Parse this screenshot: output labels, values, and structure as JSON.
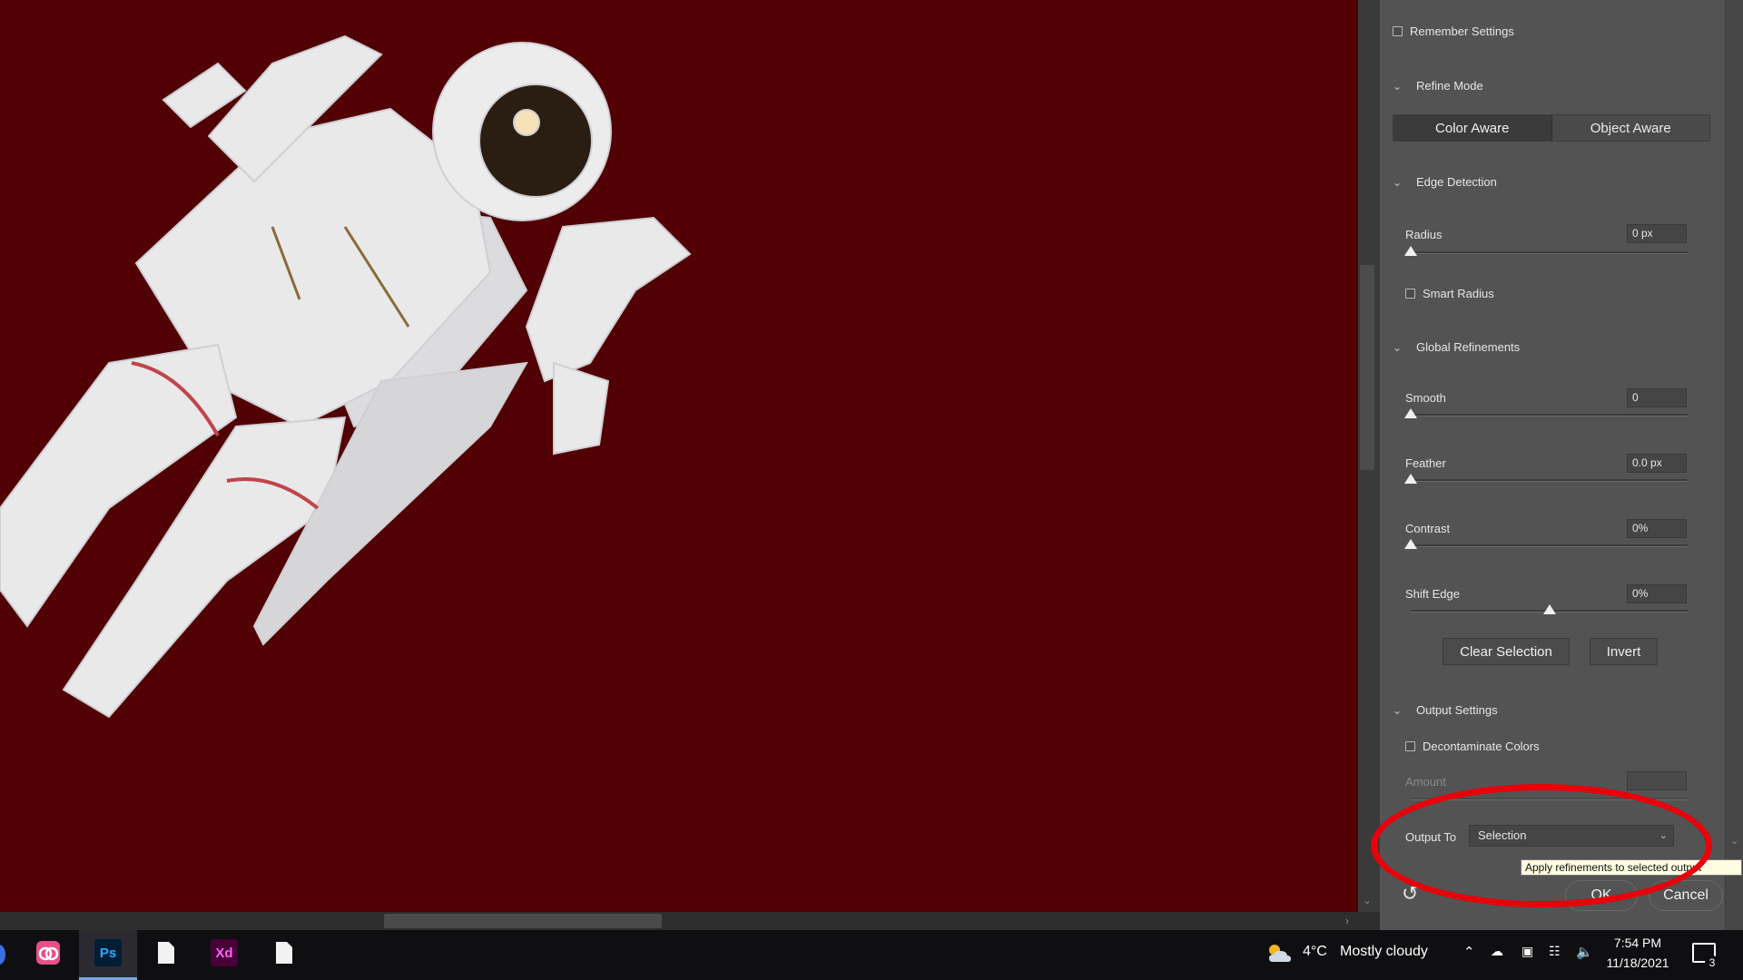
{
  "panel": {
    "remember_settings": "Remember Settings",
    "refine_mode": {
      "title": "Refine Mode",
      "options": [
        "Color Aware",
        "Object Aware"
      ],
      "selected": "Color Aware"
    },
    "edge_detection": {
      "title": "Edge Detection",
      "radius_label": "Radius",
      "radius_value": "0 px",
      "radius_level": 0,
      "smart_radius": "Smart Radius"
    },
    "global_refinements": {
      "title": "Global Refinements",
      "smooth_label": "Smooth",
      "smooth_value": "0",
      "smooth_level": 0,
      "feather_label": "Feather",
      "feather_value": "0.0 px",
      "feather_level": 0,
      "contrast_label": "Contrast",
      "contrast_value": "0%",
      "contrast_level": 0,
      "shift_edge_label": "Shift Edge",
      "shift_edge_value": "0%",
      "shift_edge_level": 0.5
    },
    "clear_selection": "Clear Selection",
    "invert": "Invert",
    "output_settings": {
      "title": "Output Settings",
      "decontaminate": "Decontaminate Colors",
      "amount_label": "Amount",
      "output_to_label": "Output To",
      "output_to_value": "Selection"
    },
    "tooltip": "Apply refinements to selected output",
    "ok": "OK",
    "cancel": "Cancel",
    "reset_icon": "reset-icon"
  },
  "colors": {
    "canvas_bg": "#510003",
    "panel_bg": "#535353",
    "annotation": "#e8000a",
    "tooltip_bg": "#fffde1"
  },
  "taskbar": {
    "apps": [
      "creative-cloud",
      "Ps",
      "file",
      "Xd",
      "file"
    ],
    "ps_label": "Ps",
    "xd_label": "Xd",
    "weather_temp": "4°C",
    "weather_text": "Mostly cloudy",
    "time": "7:54 PM",
    "date": "11/18/2021",
    "notifications": "3"
  }
}
